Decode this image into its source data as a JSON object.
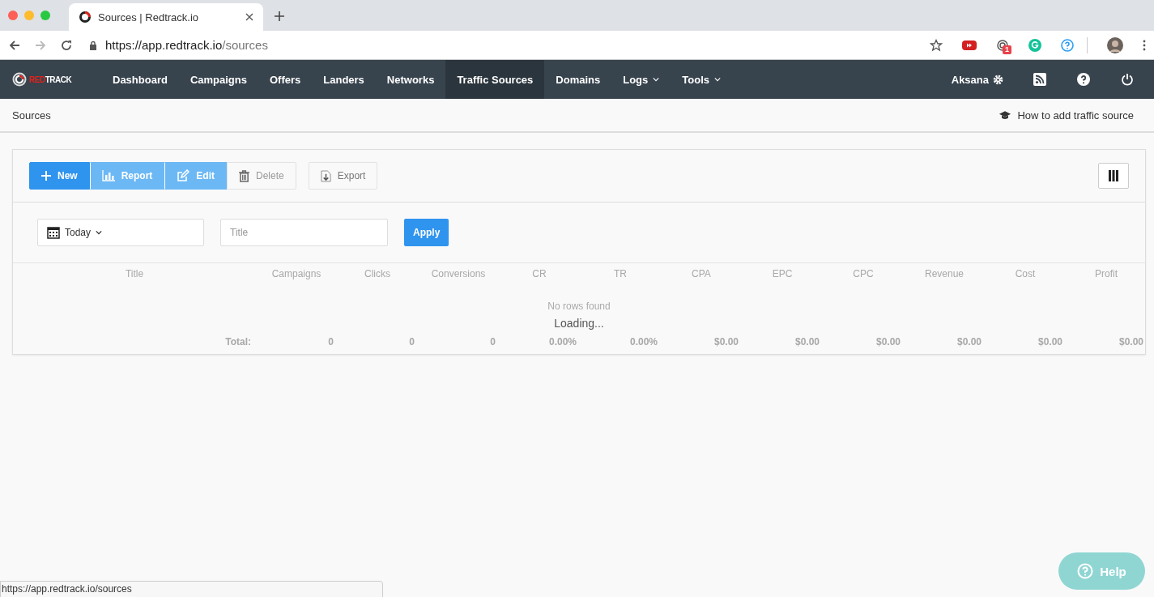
{
  "browser": {
    "tab_title": "Sources | Redtrack.io",
    "url_host": "https://app.redtrack.io",
    "url_path": "/sources",
    "extension_badge": "1",
    "status_url": "https://app.redtrack.io/sources"
  },
  "logo_parts": [
    {
      "text": "RED",
      "color": "#e0231c"
    },
    {
      "text": "TRACK",
      "color": "#ffffff"
    }
  ],
  "nav": [
    {
      "label": "Dashboard",
      "selected": false,
      "dropdown": false
    },
    {
      "label": "Campaigns",
      "selected": false,
      "dropdown": false
    },
    {
      "label": "Offers",
      "selected": false,
      "dropdown": false
    },
    {
      "label": "Landers",
      "selected": false,
      "dropdown": false
    },
    {
      "label": "Networks",
      "selected": false,
      "dropdown": false
    },
    {
      "label": "Traffic Sources",
      "selected": true,
      "dropdown": false
    },
    {
      "label": "Domains",
      "selected": false,
      "dropdown": false
    },
    {
      "label": "Logs",
      "selected": false,
      "dropdown": true
    },
    {
      "label": "Tools",
      "selected": false,
      "dropdown": true
    }
  ],
  "user": "Aksana",
  "breadcrumb": "Sources",
  "help_link": "How to add traffic source",
  "toolbar": [
    {
      "kind": "new",
      "label": "New",
      "disabled": false
    },
    {
      "kind": "report",
      "label": "Report",
      "disabled": true
    },
    {
      "kind": "edit",
      "label": "Edit",
      "disabled": true
    },
    {
      "kind": "delete",
      "label": "Delete",
      "disabled": true
    },
    {
      "kind": "export",
      "label": "Export",
      "disabled": false
    }
  ],
  "filters": {
    "date": "Today",
    "title_placeholder": "Title",
    "apply": "Apply"
  },
  "table": {
    "columns": [
      "Title",
      "Campaigns",
      "Clicks",
      "Conversions",
      "CR",
      "TR",
      "CPA",
      "EPC",
      "CPC",
      "Revenue",
      "Cost",
      "Profit"
    ],
    "empty": "No rows found",
    "loading": "Loading...",
    "totals": [
      "Total:",
      "0",
      "0",
      "0",
      "0.00%",
      "0.00%",
      "$0.00",
      "$0.00",
      "$0.00",
      "$0.00",
      "$0.00",
      "$0.00"
    ]
  },
  "help_button": "Help"
}
